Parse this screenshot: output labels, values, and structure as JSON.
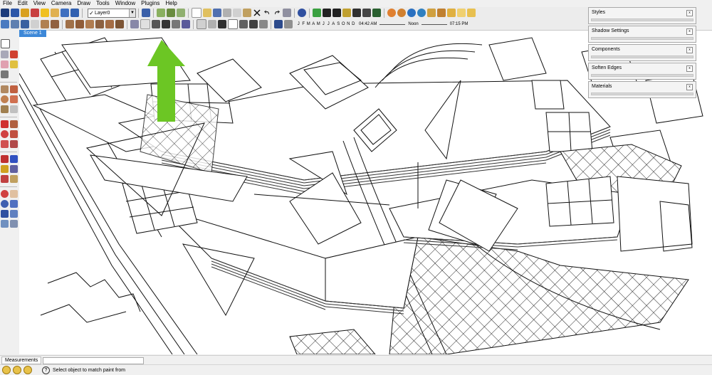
{
  "menu": [
    "File",
    "Edit",
    "View",
    "Camera",
    "Draw",
    "Tools",
    "Window",
    "Plugins",
    "Help"
  ],
  "layer": {
    "name": "Layer0"
  },
  "shadow": {
    "months": [
      "J",
      "F",
      "M",
      "A",
      "M",
      "J",
      "J",
      "A",
      "S",
      "O",
      "N",
      "D"
    ],
    "time_value": "04:42 AM",
    "noon_label": "Noon",
    "end_time": "07:15 PM"
  },
  "scene_tab": "Scene 1",
  "trays": [
    {
      "title": "Styles"
    },
    {
      "title": "Shadow Settings"
    },
    {
      "title": "Components"
    },
    {
      "title": "Soften Edges"
    },
    {
      "title": "Materials"
    }
  ],
  "measurements": {
    "label": "Measurements",
    "value": ""
  },
  "status": {
    "text": "Select object to match paint from"
  },
  "colors": {
    "arrow": "#6cc624",
    "scene_tab": "#3d88d8",
    "viewport": "#ffffff",
    "chrome": "#f0f0f0"
  },
  "icons": {
    "arrow_icon": "green-up-arrow-icon",
    "paint_tool": "paint-bucket-icon"
  }
}
